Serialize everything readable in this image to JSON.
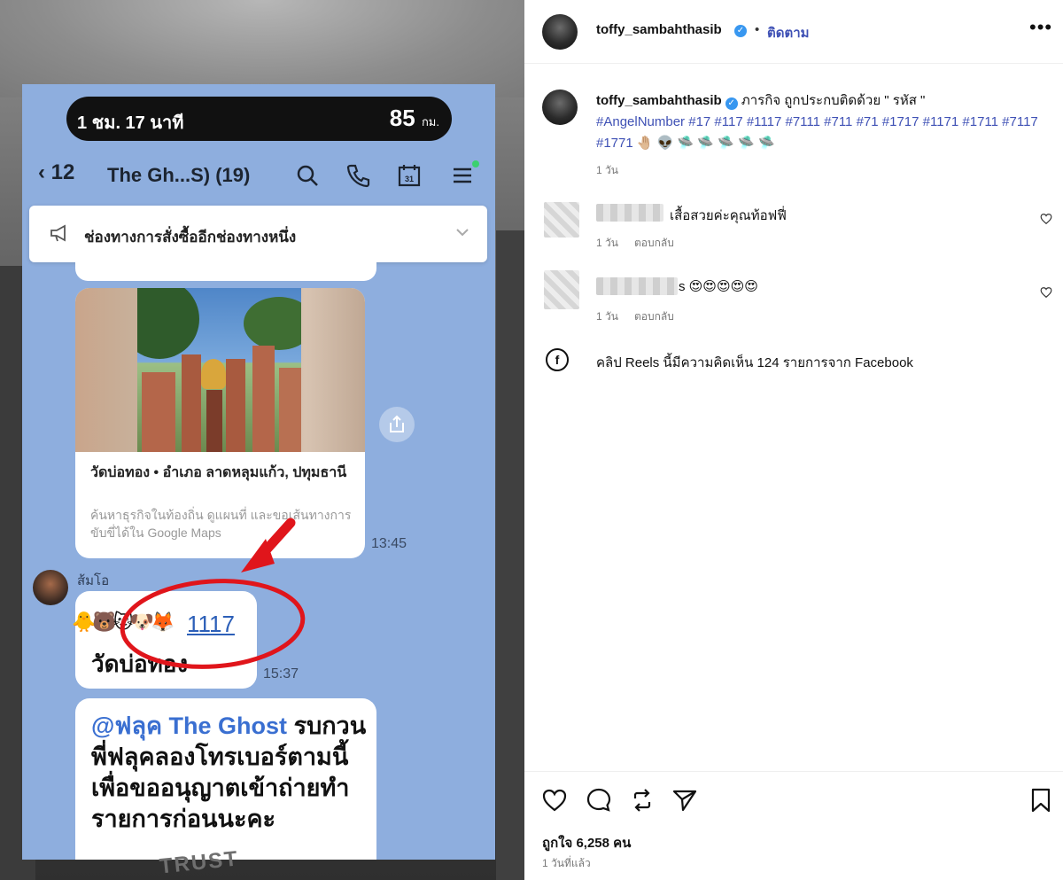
{
  "phone": {
    "status_time": "1 ชม. 17 นาที",
    "status_distance": "85",
    "status_distance_unit": "กม.",
    "header": {
      "back_count": "12",
      "title": "The Gh...S) (19)",
      "icons": [
        "search-icon",
        "phone-icon",
        "calendar-icon",
        "menu-icon"
      ],
      "calendar_day": "31"
    },
    "announcement": "ช่องทางการสั่งซื้ออีกช่องทางหนึ่ง",
    "map_card": {
      "place_name": "วัดบ่อทอง • อำเภอ ลาดหลุมแก้ว, ปทุมธานี",
      "description": "ค้นหาธุรกิจในท้องถิ่น ดูแผนที่ และขอเส้นทางการขับขี่ได้ใน Google Maps",
      "time": "13:45"
    },
    "sender_name": "ส้มโอ",
    "message_1117": {
      "emojis": "🐥🐻🐱🐶🦊",
      "number": "1117",
      "text": "วัดบ่อทอง",
      "time": "15:37"
    },
    "message_ghost": {
      "mention": "@ฟลุค The Ghost",
      "text": " รบกวนพี่ฟลุคลองโทรเบอร์ตามนี้เพื่อขออนุญาตเข้าถ่ายทำรายการก่อนนะคะ"
    },
    "watermark": "TRUST"
  },
  "instagram": {
    "username": "toffy_sambahthasib",
    "follow_label": "ติดตาม",
    "separator": "•",
    "more_label": "•••",
    "caption": {
      "text": " ภารกิจ ถูกประกบติดด้วย \" รหัส \"",
      "hashtags": "#AngelNumber #17 #117 #1117 #7111 #711 #71 #1717 #1171 #1711 #7117 #1771",
      "emojis": "🤚🏼 👽 🛸 🛸 🛸 🛸 🛸",
      "age": "1 วัน"
    },
    "comments": [
      {
        "text": "เสื้อสวยค่ะคุณท้อฟฟี่",
        "age": "1 วัน",
        "reply": "ตอบกลับ"
      },
      {
        "text": "s 😍😍😍😍😍",
        "age": "1 วัน",
        "reply": "ตอบกลับ"
      }
    ],
    "facebook_note": "คลิป Reels นี้มีความคิดเห็น 124 รายการจาก Facebook",
    "likes": "ถูกใจ 6,258 คน",
    "posted": "1 วันที่แล้ว"
  },
  "colors": {
    "chat_bg": "#8eaede",
    "link_blue": "#3f51b5",
    "annotation_red": "#e0151b"
  }
}
